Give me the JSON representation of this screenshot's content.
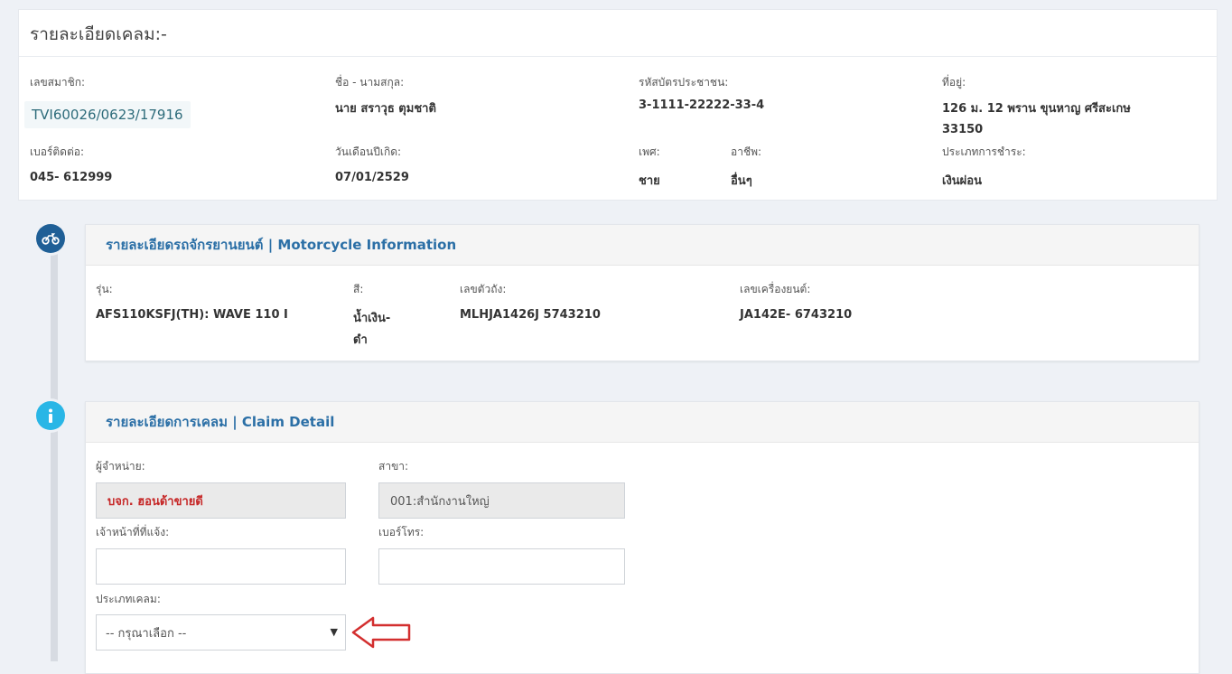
{
  "header": {
    "title": "รายละเอียดเคลม:-"
  },
  "member": {
    "id_label": "เลขสมาชิก:",
    "id_value": "TVI60026/0623/17916",
    "name_label": "ชื่อ - นามสกุล:",
    "name_value": "นาย สราวุธ ตุมชาติ",
    "citizen_label": "รหัสบัตรประชาชน:",
    "citizen_value": "3-1111-22222-33-4",
    "address_label": "ที่อยู่:",
    "address_line1": "126 ม. 12 พราน ขุนหาญ ศรีสะเกษ",
    "address_line2": "33150",
    "phone_label": "เบอร์ติดต่อ:",
    "phone_value": "045- 612999",
    "birth_label": "วันเดือนปีเกิด:",
    "birth_value": "07/01/2529",
    "sex_label": "เพศ:",
    "sex_value": "ชาย",
    "occupation_label": "อาชีพ:",
    "occupation_value": "อื่นๆ",
    "payment_label": "ประเภทการชำระ:",
    "payment_value": "เงินผ่อน"
  },
  "motorcycle": {
    "heading": "รายละเอียดรถจักรยานยนต์ | Motorcycle Information",
    "model_label": "รุ่น:",
    "model_value": "AFS110KSFJ(TH): WAVE 110 I",
    "color_label": "สี:",
    "color_line1": "น้ำเงิน-",
    "color_line2": "ดำ",
    "chassis_label": "เลขตัวถัง:",
    "chassis_value": "MLHJA1426J 5743210",
    "engine_label": "เลขเครื่องยนต์:",
    "engine_value": "JA142E- 6743210"
  },
  "claim": {
    "heading": "รายละเอียดการเคลม | Claim Detail",
    "dealer_label": "ผู้จำหน่าย:",
    "dealer_value": "บจก. ฮอนด้าขายดี",
    "branch_label": "สาขา:",
    "branch_value": "001:สำนักงานใหญ่",
    "officer_label": "เจ้าหน้าที่ที่แจ้ง:",
    "officer_value": "",
    "phone_label": "เบอร์โทร:",
    "phone_value": "",
    "type_label": "ประเภทเคลม:",
    "type_selected": "-- กรุณาเลือก --"
  },
  "colors": {
    "heading": "#2b6fa6",
    "motorcycle_icon": "#1f5f96",
    "info_icon": "#29b6e6",
    "dealer_text": "#c62828",
    "arrow": "#d32f2f"
  },
  "icons": {
    "motorcycle": "motorcycle-icon",
    "info": "info-icon",
    "dropdown": "caret-down-icon",
    "pointer": "arrow-left-icon"
  }
}
